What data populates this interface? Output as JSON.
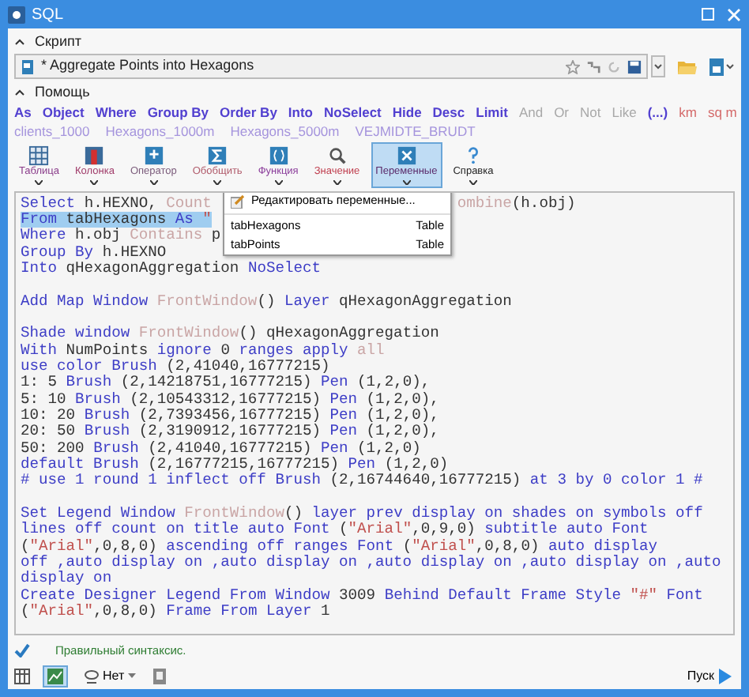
{
  "window": {
    "title": "SQL"
  },
  "script_section": {
    "title": "Скрипт",
    "expanded": true,
    "script_name": "* Aggregate Points into Hexagons"
  },
  "help_section": {
    "title": "Помощь",
    "expanded": true,
    "words": [
      {
        "text": "As",
        "kind": "keyword"
      },
      {
        "text": "Object",
        "kind": "keyword"
      },
      {
        "text": "Where",
        "kind": "keyword"
      },
      {
        "text": "Group By",
        "kind": "keyword"
      },
      {
        "text": "Order By",
        "kind": "keyword"
      },
      {
        "text": "Into",
        "kind": "keyword"
      },
      {
        "text": "NoSelect",
        "kind": "keyword"
      },
      {
        "text": "Hide",
        "kind": "keyword"
      },
      {
        "text": "Desc",
        "kind": "keyword"
      },
      {
        "text": "Limit",
        "kind": "keyword"
      },
      {
        "text": "And",
        "kind": "operator"
      },
      {
        "text": "Or",
        "kind": "operator"
      },
      {
        "text": "Not",
        "kind": "operator"
      },
      {
        "text": "Like",
        "kind": "operator"
      },
      {
        "text": "(...)",
        "kind": "keyword"
      },
      {
        "text": "km",
        "kind": "unit"
      },
      {
        "text": "sq m",
        "kind": "unit"
      }
    ],
    "tables": [
      "clients_1000",
      "Hexagons_1000m",
      "Hexagons_5000m",
      "VEJMIDTE_BRUDT"
    ]
  },
  "toolbar": [
    {
      "label": "Таблица",
      "color": "#8a3c8a",
      "selected": false
    },
    {
      "label": "Колонка",
      "color": "#a03c6a",
      "selected": false
    },
    {
      "label": "Оператор",
      "color": "#7a5a7a",
      "selected": false
    },
    {
      "label": "Обобщить",
      "color": "#b05a6a",
      "selected": false
    },
    {
      "label": "Функция",
      "color": "#8a3c9a",
      "selected": false
    },
    {
      "label": "Значение",
      "color": "#c04050",
      "selected": false
    },
    {
      "label": "Переменные",
      "color": "#5a2a6a",
      "selected": true
    },
    {
      "label": "Справка",
      "color": "#222222",
      "selected": false
    }
  ],
  "variables_menu": {
    "edit_item": "Редактировать переменные...",
    "items": [
      {
        "name": "tabHexagons",
        "type": "Table"
      },
      {
        "name": "tabPoints",
        "type": "Table"
      }
    ]
  },
  "code_lines": [
    {
      "kind": "code",
      "selected": false,
      "tokens": [
        {
          "kind": "keyword",
          "text": "Select "
        },
        {
          "kind": "plain",
          "text": "h.HEXNO, "
        },
        {
          "kind": "function",
          "text": "Count"
        }
      ],
      "tokens_after_menu": [
        {
          "kind": "function",
          "text": "ombine"
        },
        {
          "kind": "plain",
          "text": "(h.obj)"
        }
      ]
    },
    {
      "kind": "code",
      "selected": true,
      "tokens": [
        {
          "kind": "keyword",
          "text": "From "
        },
        {
          "kind": "plain",
          "text": "tabHexagons "
        },
        {
          "kind": "keyword",
          "text": "As "
        },
        {
          "kind": "string",
          "text": "\""
        }
      ]
    },
    {
      "kind": "code",
      "selected": false,
      "tokens": [
        {
          "kind": "keyword",
          "text": "Where "
        },
        {
          "kind": "plain",
          "text": "h.obj "
        },
        {
          "kind": "function",
          "text": "Contains "
        },
        {
          "kind": "plain",
          "text": "p"
        }
      ]
    },
    {
      "kind": "code",
      "selected": false,
      "tokens": [
        {
          "kind": "keyword",
          "text": "Group By "
        },
        {
          "kind": "plain",
          "text": "h.HEXNO"
        }
      ]
    },
    {
      "kind": "code",
      "selected": false,
      "tokens": [
        {
          "kind": "keyword",
          "text": "Into "
        },
        {
          "kind": "plain",
          "text": "qHexagonAggregation "
        },
        {
          "kind": "keyword",
          "text": "NoSelect"
        }
      ]
    },
    {
      "kind": "blank"
    },
    {
      "kind": "code",
      "selected": false,
      "tokens": [
        {
          "kind": "keyword",
          "text": "Add Map Window "
        },
        {
          "kind": "function",
          "text": "FrontWindow"
        },
        {
          "kind": "plain",
          "text": "() "
        },
        {
          "kind": "keyword",
          "text": "Layer "
        },
        {
          "kind": "plain",
          "text": "qHexagonAggregation"
        }
      ]
    },
    {
      "kind": "blank"
    },
    {
      "kind": "code",
      "selected": false,
      "tokens": [
        {
          "kind": "keyword",
          "text": "Shade window "
        },
        {
          "kind": "function",
          "text": "FrontWindow"
        },
        {
          "kind": "plain",
          "text": "() qHexagonAggregation"
        }
      ]
    },
    {
      "kind": "code",
      "selected": false,
      "tokens": [
        {
          "kind": "keyword",
          "text": "With "
        },
        {
          "kind": "plain",
          "text": "NumPoints "
        },
        {
          "kind": "keyword",
          "text": "ignore "
        },
        {
          "kind": "plain",
          "text": "0 "
        },
        {
          "kind": "keyword",
          "text": "ranges apply "
        },
        {
          "kind": "function",
          "text": "all"
        }
      ]
    },
    {
      "kind": "code",
      "selected": false,
      "tokens": [
        {
          "kind": "keyword",
          "text": "use color Brush "
        },
        {
          "kind": "plain",
          "text": "(2,41040,16777215)"
        }
      ]
    },
    {
      "kind": "code",
      "selected": false,
      "tokens": [
        {
          "kind": "plain",
          "text": "1: 5 "
        },
        {
          "kind": "keyword",
          "text": "Brush "
        },
        {
          "kind": "plain",
          "text": "(2,14218751,16777215) "
        },
        {
          "kind": "keyword",
          "text": "Pen "
        },
        {
          "kind": "plain",
          "text": "(1,2,0),"
        }
      ]
    },
    {
      "kind": "code",
      "selected": false,
      "tokens": [
        {
          "kind": "plain",
          "text": "5: 10 "
        },
        {
          "kind": "keyword",
          "text": "Brush "
        },
        {
          "kind": "plain",
          "text": "(2,10543312,16777215) "
        },
        {
          "kind": "keyword",
          "text": "Pen "
        },
        {
          "kind": "plain",
          "text": "(1,2,0),"
        }
      ]
    },
    {
      "kind": "code",
      "selected": false,
      "tokens": [
        {
          "kind": "plain",
          "text": "10: 20 "
        },
        {
          "kind": "keyword",
          "text": "Brush "
        },
        {
          "kind": "plain",
          "text": "(2,7393456,16777215) "
        },
        {
          "kind": "keyword",
          "text": "Pen "
        },
        {
          "kind": "plain",
          "text": "(1,2,0),"
        }
      ]
    },
    {
      "kind": "code",
      "selected": false,
      "tokens": [
        {
          "kind": "plain",
          "text": "20: 50 "
        },
        {
          "kind": "keyword",
          "text": "Brush "
        },
        {
          "kind": "plain",
          "text": "(2,3190912,16777215) "
        },
        {
          "kind": "keyword",
          "text": "Pen "
        },
        {
          "kind": "plain",
          "text": "(1,2,0),"
        }
      ]
    },
    {
      "kind": "code",
      "selected": false,
      "tokens": [
        {
          "kind": "plain",
          "text": "50: 200 "
        },
        {
          "kind": "keyword",
          "text": "Brush "
        },
        {
          "kind": "plain",
          "text": "(2,41040,16777215) "
        },
        {
          "kind": "keyword",
          "text": "Pen "
        },
        {
          "kind": "plain",
          "text": "(1,2,0)"
        }
      ]
    },
    {
      "kind": "code",
      "selected": false,
      "tokens": [
        {
          "kind": "keyword",
          "text": "default Brush "
        },
        {
          "kind": "plain",
          "text": "(2,16777215,16777215) "
        },
        {
          "kind": "keyword",
          "text": "Pen "
        },
        {
          "kind": "plain",
          "text": "(1,2,0)"
        }
      ]
    },
    {
      "kind": "code",
      "selected": false,
      "tokens": [
        {
          "kind": "keyword",
          "text": "# use 1 round 1 inflect off Brush "
        },
        {
          "kind": "plain",
          "text": "(2,16744640,16777215) "
        },
        {
          "kind": "keyword",
          "text": "at 3 by 0 color 1 #"
        }
      ]
    },
    {
      "kind": "blank"
    },
    {
      "kind": "code",
      "selected": false,
      "tokens": [
        {
          "kind": "keyword",
          "text": "Set Legend Window "
        },
        {
          "kind": "function",
          "text": "FrontWindow"
        },
        {
          "kind": "plain",
          "text": "() "
        },
        {
          "kind": "keyword",
          "text": "layer prev display on shades on symbols off"
        }
      ]
    },
    {
      "kind": "code",
      "selected": false,
      "tokens": [
        {
          "kind": "keyword",
          "text": "lines off count on title auto Font "
        },
        {
          "kind": "plain",
          "text": "("
        },
        {
          "kind": "string",
          "text": "\"Arial\""
        },
        {
          "kind": "plain",
          "text": ",0,9,0) "
        },
        {
          "kind": "keyword",
          "text": "subtitle auto Font"
        }
      ]
    },
    {
      "kind": "code",
      "selected": false,
      "tokens": [
        {
          "kind": "plain",
          "text": "("
        },
        {
          "kind": "string",
          "text": "\"Arial\""
        },
        {
          "kind": "plain",
          "text": ",0,8,0) "
        },
        {
          "kind": "keyword",
          "text": "ascending off ranges Font "
        },
        {
          "kind": "plain",
          "text": "("
        },
        {
          "kind": "string",
          "text": "\"Arial\""
        },
        {
          "kind": "plain",
          "text": ",0,8,0) "
        },
        {
          "kind": "keyword",
          "text": "auto display"
        }
      ]
    },
    {
      "kind": "code",
      "selected": false,
      "tokens": [
        {
          "kind": "keyword",
          "text": "off ,auto display on ,auto display on ,auto display on ,auto display on ,auto"
        }
      ]
    },
    {
      "kind": "code",
      "selected": false,
      "tokens": [
        {
          "kind": "keyword",
          "text": "display on"
        }
      ]
    },
    {
      "kind": "code",
      "selected": false,
      "tokens": [
        {
          "kind": "keyword",
          "text": "Create Designer Legend From Window "
        },
        {
          "kind": "plain",
          "text": "3009 "
        },
        {
          "kind": "keyword",
          "text": "Behind Default Frame Style "
        },
        {
          "kind": "string",
          "text": "\"#\" "
        },
        {
          "kind": "keyword",
          "text": "Font"
        }
      ]
    },
    {
      "kind": "code",
      "selected": false,
      "tokens": [
        {
          "kind": "plain",
          "text": "("
        },
        {
          "kind": "string",
          "text": "\"Arial\""
        },
        {
          "kind": "plain",
          "text": ",0,8,0) "
        },
        {
          "kind": "keyword",
          "text": "Frame From Layer "
        },
        {
          "kind": "plain",
          "text": "1"
        }
      ]
    }
  ],
  "status": {
    "valid": true,
    "text": "Правильный синтаксис."
  },
  "bottom_bar": {
    "dropdown_value": "Нет",
    "run_label": "Пуск"
  }
}
